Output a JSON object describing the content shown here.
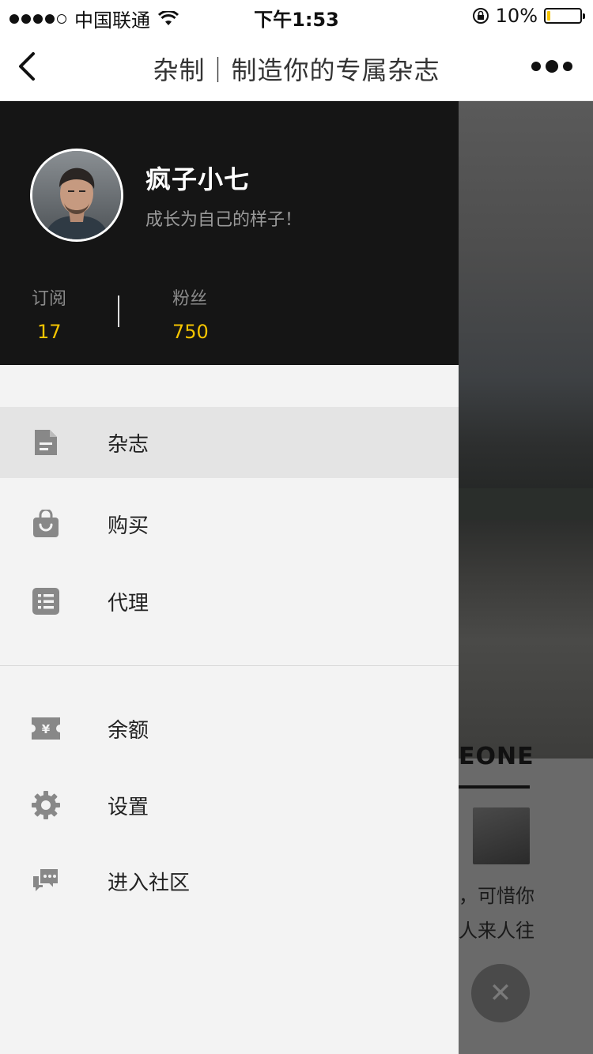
{
  "status_bar": {
    "carrier": "中国联通",
    "time": "下午1:53",
    "battery_percent": "10%",
    "battery_level": 0.1
  },
  "nav": {
    "title": "杂制｜制造你的专属杂志",
    "back_icon": "chevron-left-icon",
    "more_icon": "more-dots-icon"
  },
  "profile": {
    "name": "疯子小七",
    "bio": "成长为自己的样子！",
    "stats": [
      {
        "label": "订阅",
        "value": "17"
      },
      {
        "label": "粉丝",
        "value": "750"
      }
    ]
  },
  "menu": {
    "primary": [
      {
        "label": "杂志",
        "icon": "document-icon",
        "active": true
      },
      {
        "label": "购买",
        "icon": "shopping-bag-icon",
        "active": false
      },
      {
        "label": "代理",
        "icon": "list-icon",
        "active": false
      }
    ],
    "secondary": [
      {
        "label": "余额",
        "icon": "yen-ticket-icon"
      },
      {
        "label": "设置",
        "icon": "gear-icon"
      },
      {
        "label": "进入社区",
        "icon": "chat-bubbles-icon"
      }
    ]
  },
  "background_page": {
    "heading_fragment": "EONE",
    "text_line1": "，可惜你",
    "text_line2": "人来人往",
    "close_symbol": "✕"
  },
  "colors": {
    "accent": "#f5c400",
    "drawer_header": "#151515",
    "drawer_bg": "#f3f3f3",
    "active_item": "#e4e4e4",
    "icon_gray": "#888888"
  }
}
